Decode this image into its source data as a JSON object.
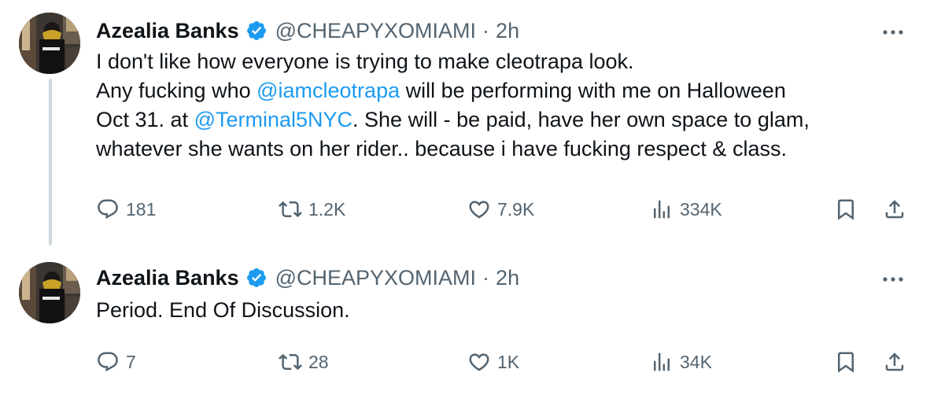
{
  "tweets": [
    {
      "author": {
        "name": "Azealia Banks",
        "handle": "@CHEAPYXOMIAMI",
        "verified": true
      },
      "separator": "·",
      "time": "2h",
      "text": {
        "line1": "I don't like how everyone is trying to make cleotrapa look.",
        "line2_pre": "Any fucking who ",
        "line2_mention": "@iamcleotrapa",
        "line2_post": " will be performing with me on Halloween",
        "line3_pre": "Oct 31. at ",
        "line3_mention": "@Terminal5NYC",
        "line3_post": ". She will - be paid, have her own space to glam,",
        "line4": "whatever she wants on her rider.. because i have fucking respect & class."
      },
      "stats": {
        "replies": "181",
        "reposts": "1.2K",
        "likes": "7.9K",
        "views": "334K"
      }
    },
    {
      "author": {
        "name": "Azealia Banks",
        "handle": "@CHEAPYXOMIAMI",
        "verified": true
      },
      "separator": "·",
      "time": "2h",
      "text": {
        "line1": "Period. End Of Discussion."
      },
      "stats": {
        "replies": "7",
        "reposts": "28",
        "likes": "1K",
        "views": "34K"
      }
    }
  ],
  "colors": {
    "text": "#0f1419",
    "secondary": "#536471",
    "link": "#1d9bf0",
    "verified_badge": "#1d9bf0",
    "thread_line": "#cfd9de"
  },
  "icons": {
    "reply": "speech-bubble-icon",
    "repost": "repost-arrows-icon",
    "like": "heart-icon",
    "views": "bar-chart-icon",
    "bookmark": "bookmark-icon",
    "share": "share-upload-icon",
    "more": "more-dots-icon",
    "verified": "verified-badge-icon"
  }
}
